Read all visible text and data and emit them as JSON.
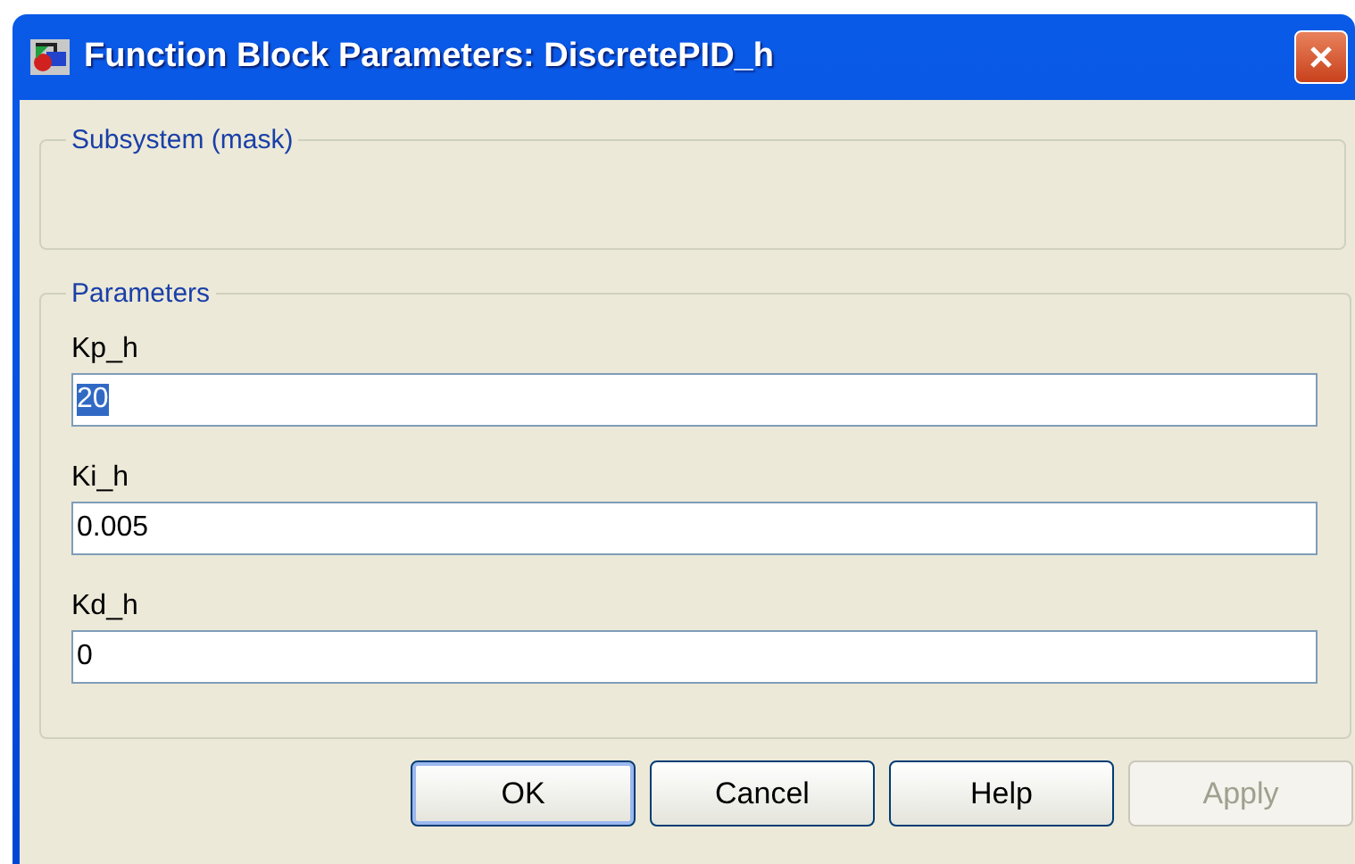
{
  "window": {
    "title": "Function Block Parameters: DiscretePID_h"
  },
  "description_group": {
    "title": "Subsystem (mask)"
  },
  "parameters_group": {
    "title": "Parameters",
    "params": [
      {
        "label": "Kp_h",
        "value": "20",
        "text_selected": true
      },
      {
        "label": "Ki_h",
        "value": "0.005",
        "text_selected": false
      },
      {
        "label": "Kd_h",
        "value": "0",
        "text_selected": false
      }
    ]
  },
  "buttons": [
    {
      "label": "OK",
      "default": true,
      "disabled": false
    },
    {
      "label": "Cancel",
      "default": false,
      "disabled": false
    },
    {
      "label": "Help",
      "default": false,
      "disabled": false
    },
    {
      "label": "Apply",
      "default": false,
      "disabled": true
    }
  ]
}
